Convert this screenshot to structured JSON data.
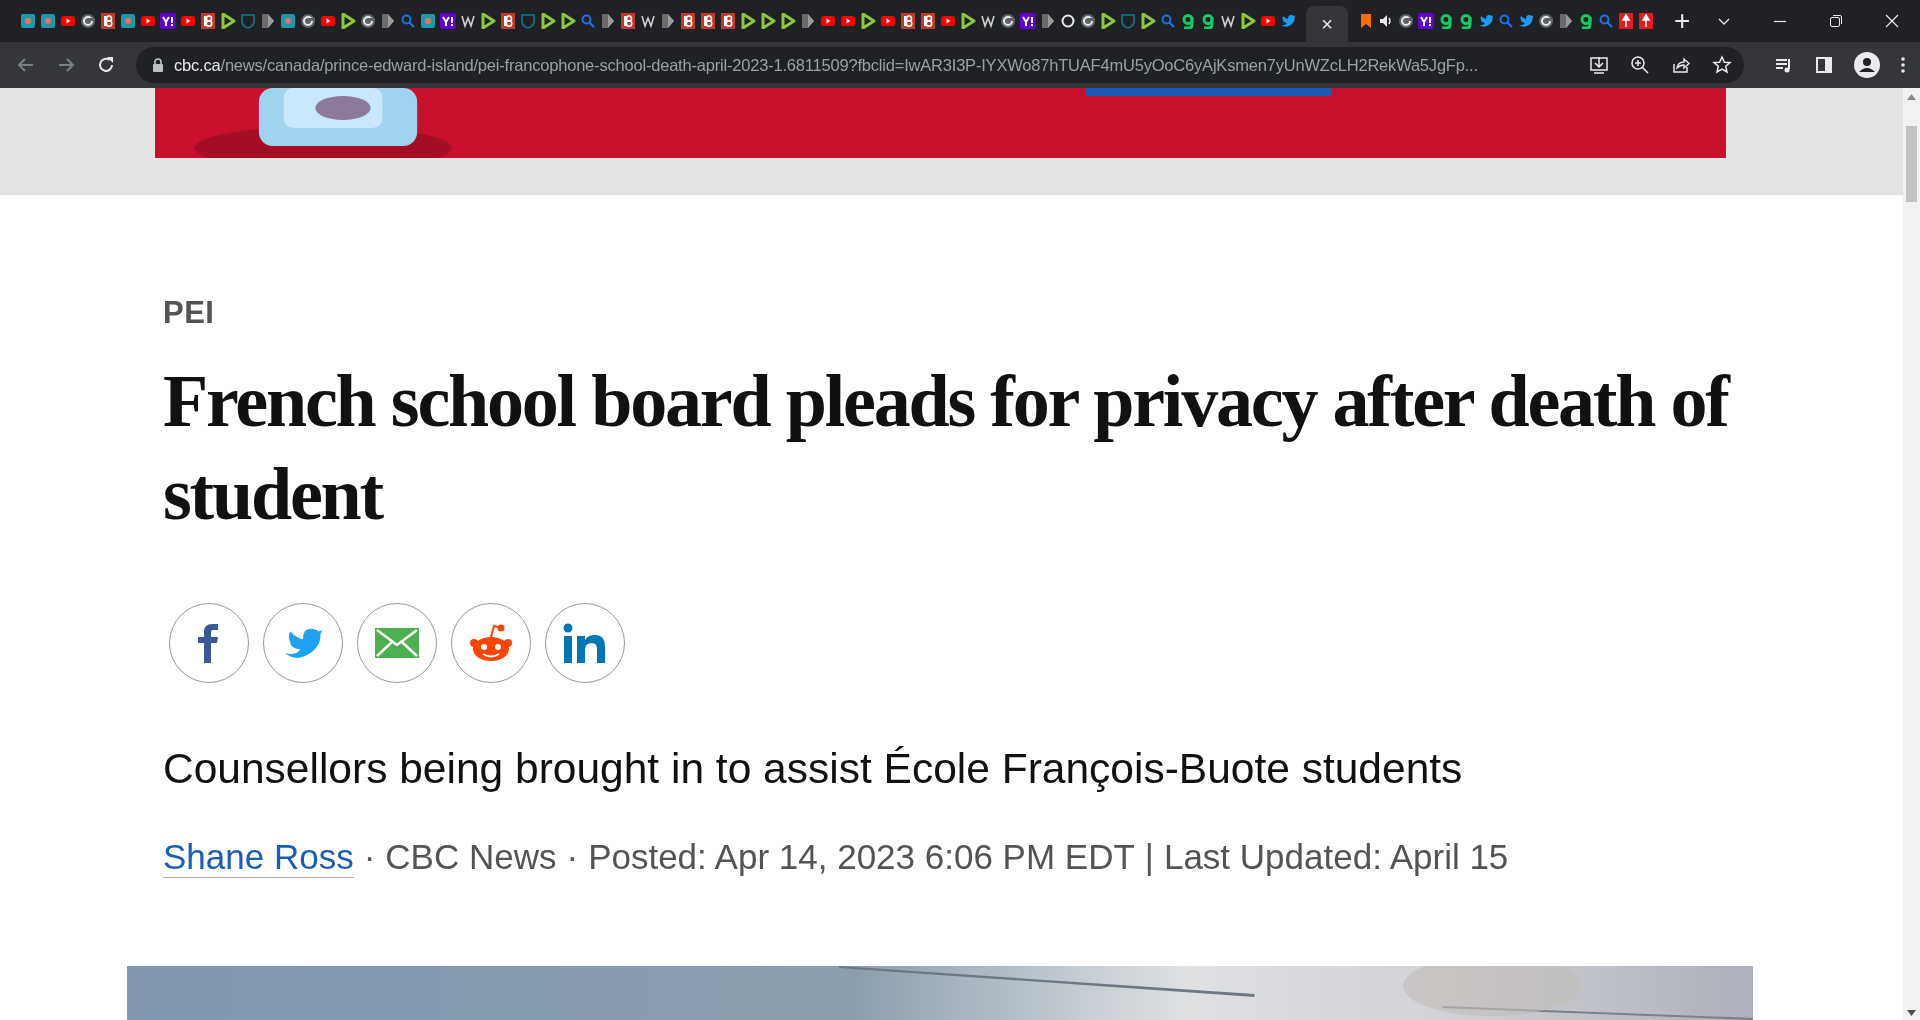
{
  "browser": {
    "tabs": [
      {
        "kind": "misc",
        "selected": false
      },
      {
        "kind": "misc",
        "selected": false
      },
      {
        "kind": "yt",
        "selected": false
      },
      {
        "kind": "globe",
        "selected": false
      },
      {
        "kind": "b",
        "selected": false
      },
      {
        "kind": "misc",
        "selected": false
      },
      {
        "kind": "yt",
        "selected": false
      },
      {
        "kind": "yahoo",
        "selected": false
      },
      {
        "kind": "yt",
        "selected": false
      },
      {
        "kind": "b",
        "selected": false
      },
      {
        "kind": "play",
        "selected": false
      },
      {
        "kind": "shield",
        "selected": false
      },
      {
        "kind": "gray",
        "selected": false
      },
      {
        "kind": "misc",
        "selected": false
      },
      {
        "kind": "globe",
        "selected": false
      },
      {
        "kind": "yt",
        "selected": false
      },
      {
        "kind": "play",
        "selected": false
      },
      {
        "kind": "globe",
        "selected": false
      },
      {
        "kind": "gray",
        "selected": false
      },
      {
        "kind": "search",
        "selected": false
      },
      {
        "kind": "misc",
        "selected": false
      },
      {
        "kind": "yahoo",
        "selected": false
      },
      {
        "kind": "wiki",
        "selected": false
      },
      {
        "kind": "play",
        "selected": false
      },
      {
        "kind": "b",
        "selected": false
      },
      {
        "kind": "shield",
        "selected": false
      },
      {
        "kind": "play",
        "selected": false
      },
      {
        "kind": "play",
        "selected": false
      },
      {
        "kind": "search",
        "selected": false
      },
      {
        "kind": "gray",
        "selected": false
      },
      {
        "kind": "b",
        "selected": false
      },
      {
        "kind": "wiki",
        "selected": false
      },
      {
        "kind": "gray",
        "selected": false
      },
      {
        "kind": "b",
        "selected": false
      },
      {
        "kind": "b",
        "selected": false
      },
      {
        "kind": "b",
        "selected": false
      },
      {
        "kind": "play",
        "selected": false
      },
      {
        "kind": "play",
        "selected": false
      },
      {
        "kind": "play",
        "selected": false
      },
      {
        "kind": "gray",
        "selected": false
      },
      {
        "kind": "yt",
        "selected": false
      },
      {
        "kind": "yt",
        "selected": false
      },
      {
        "kind": "play",
        "selected": false
      },
      {
        "kind": "yt",
        "selected": false
      },
      {
        "kind": "b",
        "selected": false
      },
      {
        "kind": "b",
        "selected": false
      },
      {
        "kind": "yt",
        "selected": false
      },
      {
        "kind": "play",
        "selected": false
      },
      {
        "kind": "wiki",
        "selected": false
      },
      {
        "kind": "globe",
        "selected": false
      },
      {
        "kind": "yahoo",
        "selected": false
      },
      {
        "kind": "gray",
        "selected": false
      },
      {
        "kind": "ring",
        "selected": false
      },
      {
        "kind": "globe",
        "selected": false
      },
      {
        "kind": "play",
        "selected": false
      },
      {
        "kind": "shield",
        "selected": false
      },
      {
        "kind": "play",
        "selected": false
      },
      {
        "kind": "search",
        "selected": false
      },
      {
        "kind": "g",
        "selected": false
      },
      {
        "kind": "g",
        "selected": false
      },
      {
        "kind": "wiki",
        "selected": false
      },
      {
        "kind": "play",
        "selected": false
      },
      {
        "kind": "yt",
        "selected": false
      },
      {
        "kind": "twitter",
        "selected": false
      },
      {
        "kind": "close",
        "selected": true,
        "close": "×"
      },
      {
        "kind": "bookmark",
        "selected": false
      },
      {
        "kind": "speaker",
        "selected": false
      },
      {
        "kind": "globe",
        "selected": false
      },
      {
        "kind": "yahoo",
        "selected": false
      },
      {
        "kind": "g",
        "selected": false
      },
      {
        "kind": "g",
        "selected": false
      },
      {
        "kind": "twitter",
        "selected": false
      },
      {
        "kind": "search",
        "selected": false
      },
      {
        "kind": "twitter",
        "selected": false
      },
      {
        "kind": "globe",
        "selected": false
      },
      {
        "kind": "gray",
        "selected": false
      },
      {
        "kind": "g",
        "selected": false
      },
      {
        "kind": "search",
        "selected": false
      },
      {
        "kind": "pin",
        "selected": false
      },
      {
        "kind": "pin",
        "selected": false
      }
    ],
    "new_tab": "+",
    "url": {
      "domain": "cbc.ca",
      "path": "/news/canada/prince-edward-island/pei-francophone-school-death-april-2023-1.6811509?fbclid=IwAR3I3P-IYXWo87hTUAF4mU5yOoC6yAjKsmen7yUnWZcLH2RekWa5JgFp..."
    }
  },
  "article": {
    "section": "PEI",
    "headline": "French school board pleads for privacy after death of student",
    "share_buttons": [
      {
        "kind": "facebook"
      },
      {
        "kind": "twitter"
      },
      {
        "kind": "email"
      },
      {
        "kind": "reddit"
      },
      {
        "kind": "linkedin"
      }
    ],
    "subtitle": "Counsellors being brought in to assist École François-Buote students",
    "byline": {
      "author": "Shane Ross",
      "items": [
        "·",
        "CBC News",
        "·",
        "Posted: Apr 14, 2023 6:06 PM EDT",
        "|",
        "Last Updated: April 15"
      ]
    }
  }
}
